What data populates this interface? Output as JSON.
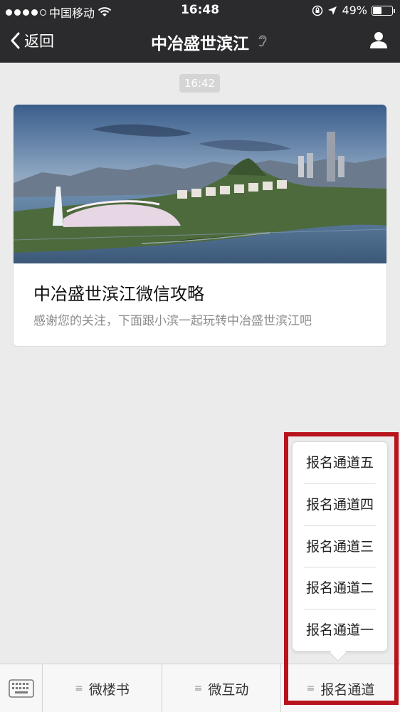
{
  "status_bar": {
    "carrier": "中国移动",
    "time": "16:48",
    "battery_percent": "49%",
    "battery_level": 0.49
  },
  "nav": {
    "back_label": "返回",
    "title": "中冶盛世滨江"
  },
  "chat": {
    "timestamp": "16:42",
    "article": {
      "title": "中冶盛世滨江微信攻略",
      "description": "感谢您的关注，下面跟小滨一起玩转中冶盛世滨江吧"
    }
  },
  "popup_menu": {
    "items": [
      "报名通道五",
      "报名通道四",
      "报名通道三",
      "报名通道二",
      "报名通道一"
    ]
  },
  "bottom_menu": {
    "items": [
      "微楼书",
      "微互动",
      "报名通道"
    ]
  },
  "colors": {
    "nav_bg": "#2b2b2d",
    "chat_bg": "#ebebeb",
    "highlight": "#b8121c"
  }
}
